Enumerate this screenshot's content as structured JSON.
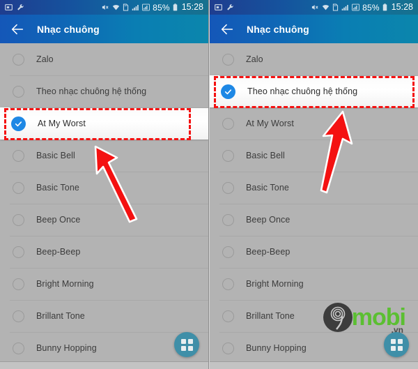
{
  "meta": {
    "watermark_text": "mobi",
    "watermark_suffix": ".vn",
    "watermark_digit": "9"
  },
  "status_bar": {
    "icons": [
      "screenshot-icon",
      "wrench-icon",
      "mute-icon",
      "wifi-icon",
      "sd-card-icon",
      "signal-1-icon",
      "signal-2-icon"
    ],
    "battery_percent": "85%",
    "time": "15:28"
  },
  "toolbar": {
    "back_label": "back-arrow",
    "title": "Nhạc chuông"
  },
  "panels": [
    {
      "id": "left",
      "selected_index": 2,
      "highlight_index": 2,
      "items": [
        {
          "label": "Zalo",
          "checked": false
        },
        {
          "label": "Theo nhạc chuông hệ thống",
          "checked": false
        },
        {
          "label": "At My Worst",
          "checked": true
        },
        {
          "label": "Basic Bell",
          "checked": false
        },
        {
          "label": "Basic Tone",
          "checked": false
        },
        {
          "label": "Beep Once",
          "checked": false
        },
        {
          "label": "Beep-Beep",
          "checked": false
        },
        {
          "label": "Bright Morning",
          "checked": false
        },
        {
          "label": "Brillant Tone",
          "checked": false
        },
        {
          "label": "Bunny Hopping",
          "checked": false
        }
      ]
    },
    {
      "id": "right",
      "selected_index": 1,
      "highlight_index": 1,
      "items": [
        {
          "label": "Zalo",
          "checked": false
        },
        {
          "label": "Theo nhạc chuông hệ thống",
          "checked": true
        },
        {
          "label": "At My Worst",
          "checked": false
        },
        {
          "label": "Basic Bell",
          "checked": false
        },
        {
          "label": "Basic Tone",
          "checked": false
        },
        {
          "label": "Beep Once",
          "checked": false
        },
        {
          "label": "Beep-Beep",
          "checked": false
        },
        {
          "label": "Bright Morning",
          "checked": false
        },
        {
          "label": "Brillant Tone",
          "checked": false
        },
        {
          "label": "Bunny Hopping",
          "checked": false
        }
      ]
    }
  ],
  "fab": {
    "icon": "grid-apps-icon"
  },
  "colors": {
    "accent_blue": "#1e88e5",
    "highlight_red": "#f41111",
    "toolbar_start": "#1457b8",
    "toolbar_end": "#0b86ac",
    "fab_teal": "#3f8fa8",
    "watermark_green": "#5bbf32"
  }
}
